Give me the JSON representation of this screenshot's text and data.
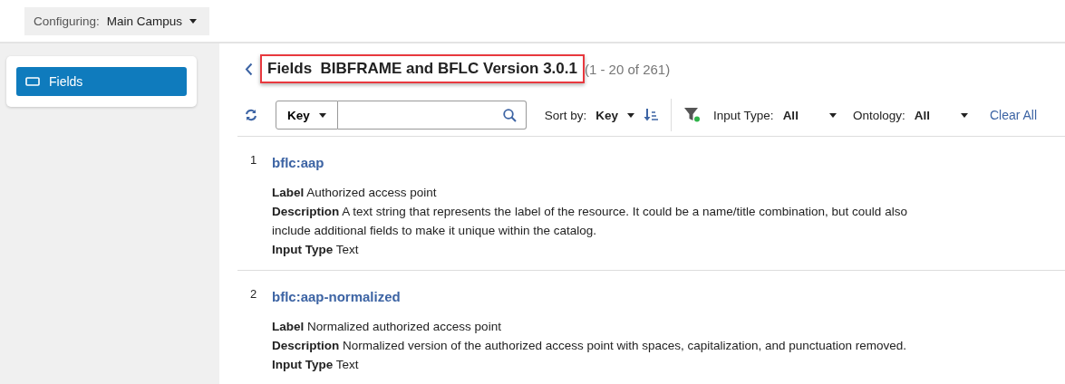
{
  "top_bar": {
    "configuring_label": "Configuring:",
    "configuring_value": "Main Campus"
  },
  "sidebar": {
    "items": [
      {
        "label": "Fields",
        "selected": true
      }
    ]
  },
  "header": {
    "title": "Fields  BIBFRAME and BFLC Version 3.0.1",
    "highlighted": true,
    "count": "(1 - 20 of 261)"
  },
  "toolbar": {
    "search_scope": "Key",
    "sort_label": "Sort by:",
    "sort_value": "Key",
    "filters": [
      {
        "label": "Input Type:",
        "value": "All"
      },
      {
        "label": "Ontology:",
        "value": "All"
      }
    ],
    "filter_active": true,
    "clear_all": "Clear All"
  },
  "fields": [
    {
      "index": "1",
      "key": "bflc:aap",
      "details": [
        {
          "name": "Label",
          "value": "Authorized access point"
        },
        {
          "name": "Description",
          "value": "A text string that represents the label of the resource. It could be a name/title combination, but could also include additional fields to make it unique within the catalog."
        },
        {
          "name": "Input Type",
          "value": "Text"
        }
      ]
    },
    {
      "index": "2",
      "key": "bflc:aap-normalized",
      "details": [
        {
          "name": "Label",
          "value": "Normalized authorized access point"
        },
        {
          "name": "Description",
          "value": "Normalized version of the authorized access point with spaces, capitalization, and punctuation removed."
        },
        {
          "name": "Input Type",
          "value": "Text"
        }
      ]
    }
  ]
}
